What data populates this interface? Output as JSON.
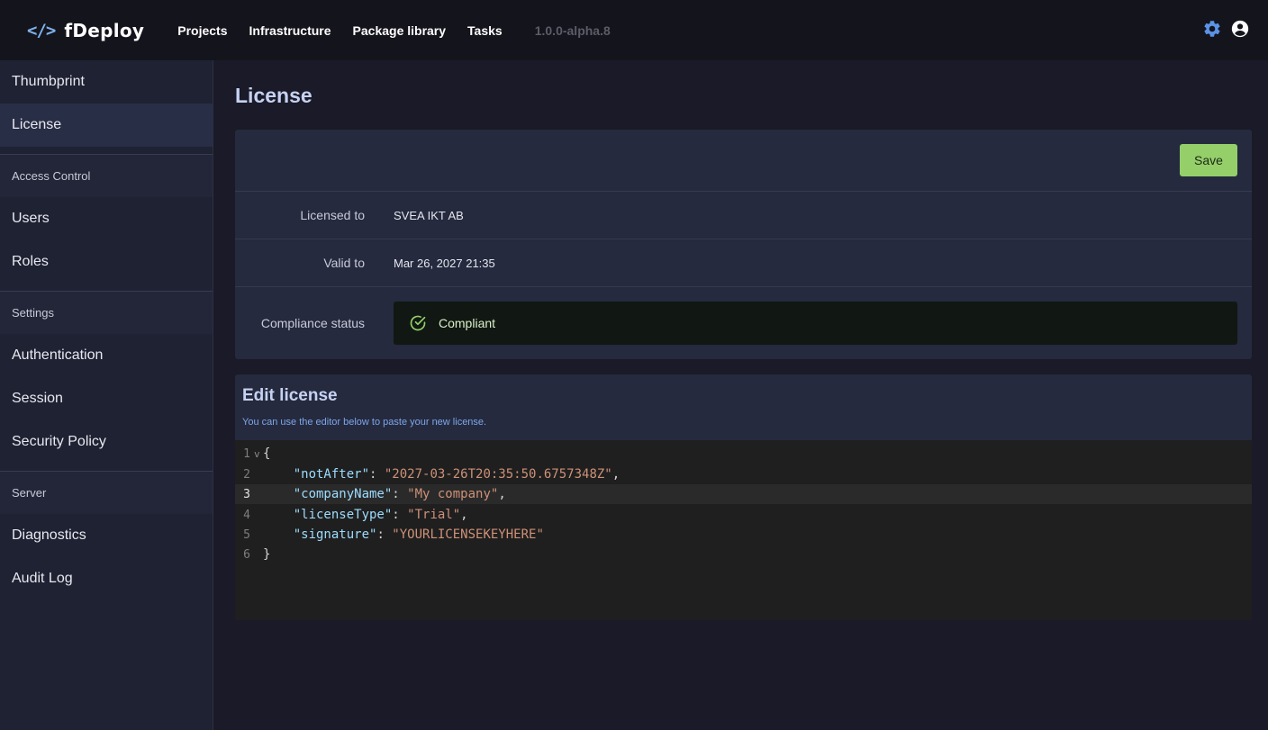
{
  "app": {
    "brand_icon": "</>",
    "name": "fDeploy",
    "version": "1.0.0-alpha.8",
    "accent_color": "#7fb2ee"
  },
  "nav": {
    "items": [
      {
        "label": "Projects"
      },
      {
        "label": "Infrastructure"
      },
      {
        "label": "Package library"
      },
      {
        "label": "Tasks"
      }
    ],
    "icons": [
      "gear-icon",
      "user-circle-icon"
    ]
  },
  "sidebar": {
    "top_items": [
      {
        "label": "Thumbprint",
        "active": false
      },
      {
        "label": "License",
        "active": true
      }
    ],
    "sections": [
      {
        "title": "Access Control",
        "items": [
          {
            "label": "Users"
          },
          {
            "label": "Roles"
          }
        ]
      },
      {
        "title": "Settings",
        "items": [
          {
            "label": "Authentication"
          },
          {
            "label": "Session"
          },
          {
            "label": "Security Policy"
          }
        ]
      },
      {
        "title": "Server",
        "items": [
          {
            "label": "Diagnostics"
          },
          {
            "label": "Audit Log"
          }
        ]
      }
    ]
  },
  "page": {
    "title": "License",
    "save_label": "Save",
    "fields": {
      "licensed_to_label": "Licensed to",
      "licensed_to_value": "SVEA IKT AB",
      "valid_to_label": "Valid to",
      "valid_to_value": "Mar 26, 2027 21:35",
      "compliance_label": "Compliance status",
      "compliance_value": "Compliant",
      "compliance_color": "#94cf6a"
    }
  },
  "edit": {
    "title": "Edit license",
    "subtitle": "You can use the editor below to paste your new license.",
    "current_line": 3,
    "lines": [
      {
        "n": "1",
        "text": "{"
      },
      {
        "n": "2",
        "key": "\"notAfter\"",
        "value": "\"2027-03-26T20:35:50.6757348Z\"",
        "comma": ","
      },
      {
        "n": "3",
        "key": "\"companyName\"",
        "value": "\"My company\"",
        "comma": ","
      },
      {
        "n": "4",
        "key": "\"licenseType\"",
        "value": "\"Trial\"",
        "comma": ","
      },
      {
        "n": "5",
        "key": "\"signature\"",
        "value": "\"YOURLICENSEKEYHERE\"",
        "comma": ""
      },
      {
        "n": "6",
        "text": "}"
      }
    ]
  }
}
